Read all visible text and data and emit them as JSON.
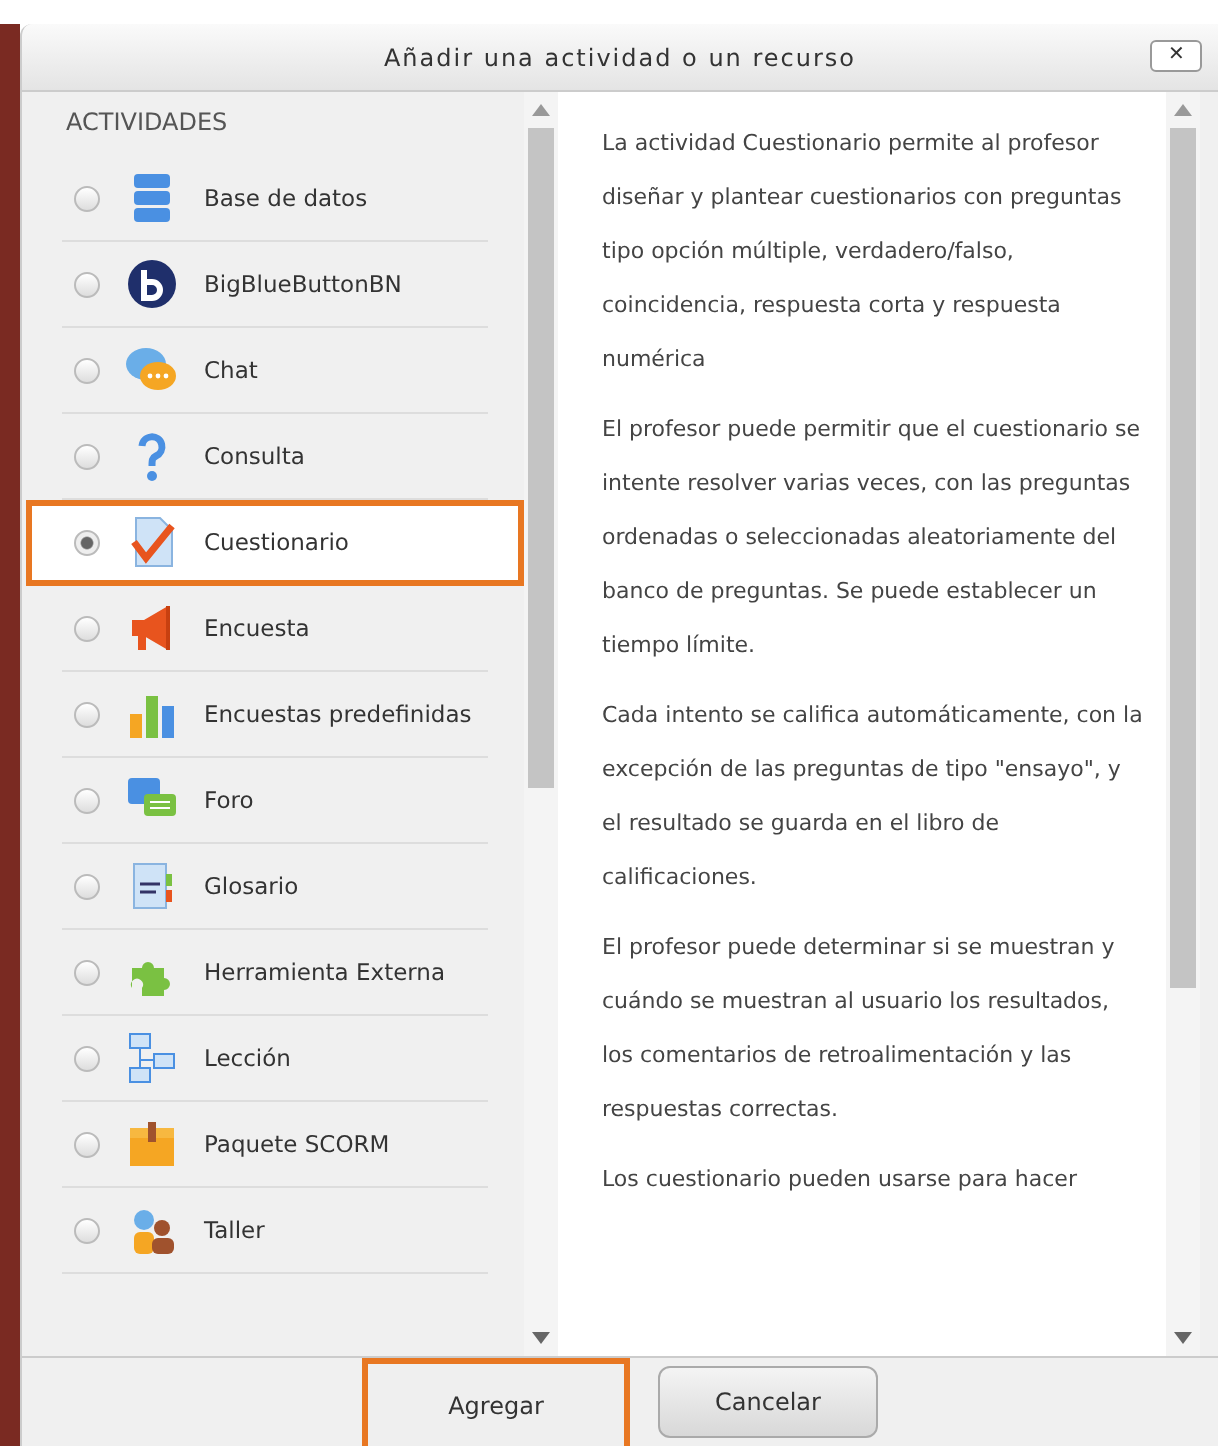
{
  "dialog": {
    "title": "Añadir una actividad o un recurso",
    "close": "✕"
  },
  "section_heading": "ACTIVIDADES",
  "activities": [
    {
      "label": "Base de datos",
      "selected": false,
      "highlighted": false
    },
    {
      "label": "BigBlueButtonBN",
      "selected": false,
      "highlighted": false
    },
    {
      "label": "Chat",
      "selected": false,
      "highlighted": false
    },
    {
      "label": "Consulta",
      "selected": false,
      "highlighted": false
    },
    {
      "label": "Cuestionario",
      "selected": true,
      "highlighted": true
    },
    {
      "label": "Encuesta",
      "selected": false,
      "highlighted": false
    },
    {
      "label": "Encuestas predefinidas",
      "selected": false,
      "highlighted": false
    },
    {
      "label": "Foro",
      "selected": false,
      "highlighted": false
    },
    {
      "label": "Glosario",
      "selected": false,
      "highlighted": false
    },
    {
      "label": "Herramienta Externa",
      "selected": false,
      "highlighted": false
    },
    {
      "label": "Lección",
      "selected": false,
      "highlighted": false
    },
    {
      "label": "Paquete SCORM",
      "selected": false,
      "highlighted": false
    },
    {
      "label": "Taller",
      "selected": false,
      "highlighted": false
    }
  ],
  "description": [
    "La actividad Cuestionario permite al profesor diseñar y plantear cuestionarios con preguntas tipo opción múltiple, verdadero/falso, coincidencia, respuesta corta y respuesta numérica",
    "El profesor puede permitir que el cuestionario se intente resolver varias veces, con las preguntas ordenadas o seleccionadas aleatoriamente del banco de preguntas. Se puede establecer un tiempo límite.",
    "Cada intento se califica automáticamente, con la excepción de las preguntas de tipo \"ensayo\", y el resultado se guarda en el libro de calificaciones.",
    "El profesor puede determinar si se muestran y cuándo se muestran al usuario los resultados, los comentarios de retroalimentación y las respuestas correctas.",
    "Los cuestionario pueden usarse para hacer"
  ],
  "buttons": [
    {
      "label": "Agregar",
      "highlighted": true
    },
    {
      "label": "Cancelar",
      "highlighted": false
    }
  ]
}
